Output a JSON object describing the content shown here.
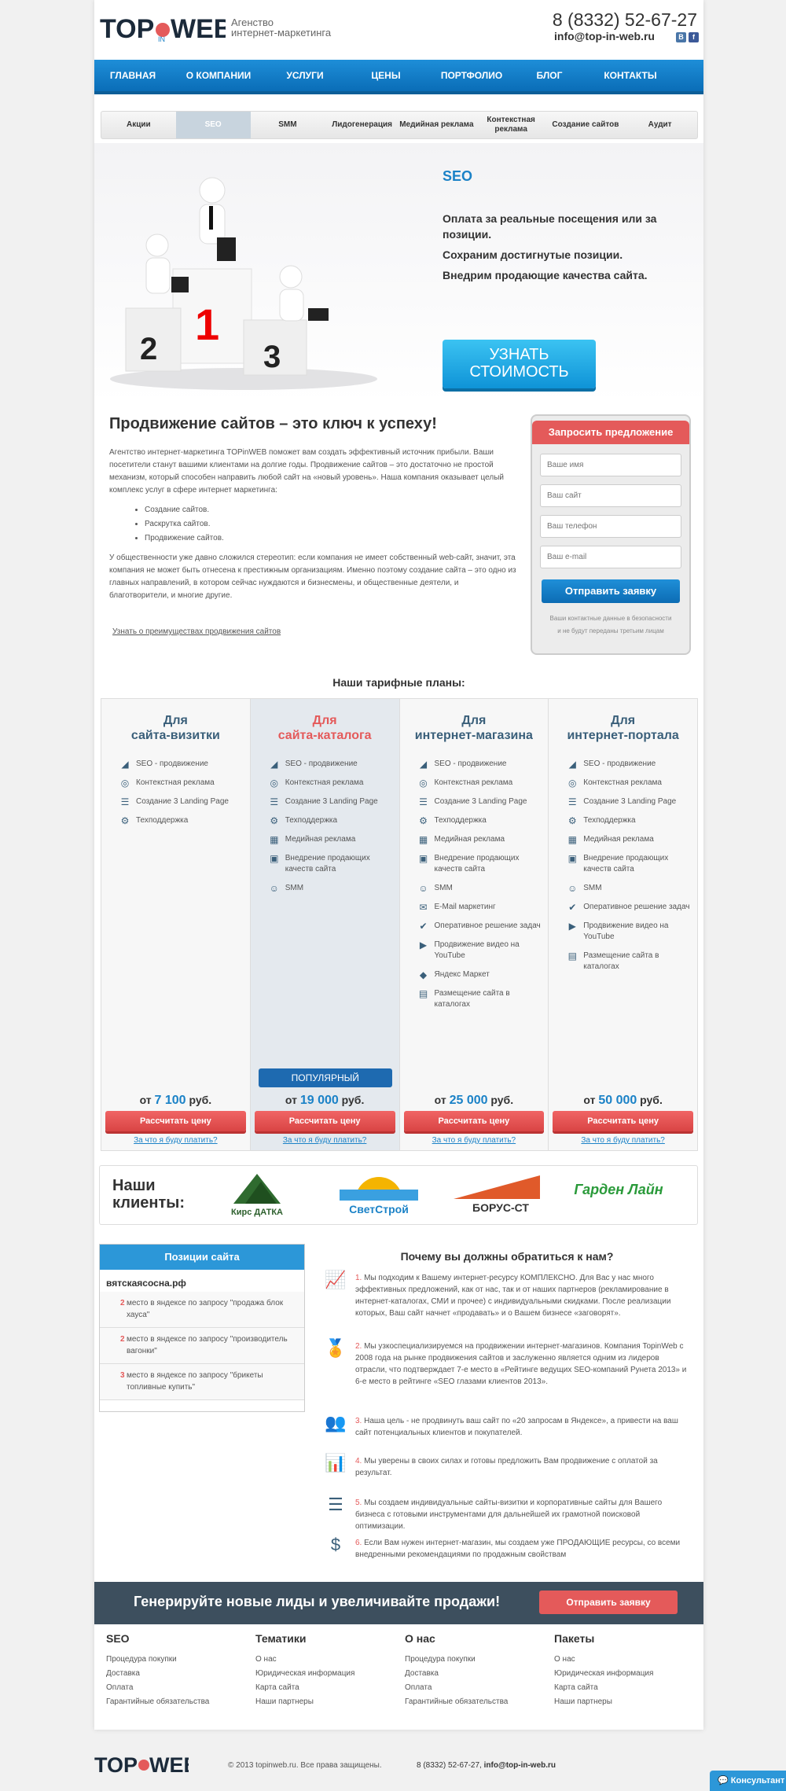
{
  "header": {
    "logo_text": "TOP IN WEB",
    "tagline_1": "Агенство",
    "tagline_2": "интернет-маркетинга",
    "phone": "8 (8332) 52-67-27",
    "email": "info@top-in-web.ru"
  },
  "nav": [
    "ГЛАВНАЯ",
    "О КОМПАНИИ",
    "УСЛУГИ",
    "ЦЕНЫ",
    "ПОРТФОЛИО",
    "БЛОГ",
    "КОНТАКТЫ"
  ],
  "subnav": [
    "Акции",
    "SEO",
    "SMM",
    "Лидогенерация",
    "Медийная реклама",
    "Контекстная реклама",
    "Создание сайтов",
    "Аудит"
  ],
  "hero": {
    "title": "SEO",
    "lines": [
      "Оплата за реальные посещения или за позиции.",
      "Сохраним достигнутые позиции.",
      "Внедрим продающие качества сайта."
    ],
    "button": "УЗНАТЬ СТОИМОСТЬ"
  },
  "intro": {
    "heading": "Продвижение сайтов – это ключ к успеху!",
    "p1": "Агентство интернет-маркетинга TOPinWEB поможет вам создать эффективный источник прибыли. Ваши посетители станут вашими клиентами на долгие годы. Продвижение сайтов – это достаточно не простой механизм, который способен направить любой сайт на «новый уровень». Наша компания оказывает целый комплекс услуг в сфере интернет маркетинга:",
    "list": [
      "Создание сайтов.",
      "Раскрутка сайтов.",
      "Продвижение сайтов."
    ],
    "p2": "У общественности уже давно сложился стереотип: если компания не имеет собственный web-сайт, значит, эта компания не может быть отнесена к престижным организациям. Именно поэтому создание сайта – это одно из главных направлений, в котором сейчас нуждаются и бизнесмены, и общественные деятели, и благотворители, и многие другие.",
    "link": "Узнать о преимуществах продвижения сайтов"
  },
  "form": {
    "title": "Запросить предложение",
    "name_ph": "Ваше имя",
    "site_ph": "Ваш сайт",
    "phone_ph": "Ваш телефон",
    "email_ph": "Ваш e-mail",
    "submit": "Отправить заявку",
    "note1": "Ваши контактные данные в безопасности",
    "note2": "и не будут переданы третьим лицам"
  },
  "plans_title": "Наши тарифные планы:",
  "plans": [
    {
      "name1": "Для",
      "name2": "сайта-визитки",
      "features": [
        "SEO - продвижение",
        "Контекстная реклама",
        "Создание 3 Landing Page",
        "Техподдержка"
      ],
      "price_prefix": "от",
      "price": "7 100",
      "currency": "руб.",
      "button": "Рассчитать цену",
      "why": "За что я буду платить?"
    },
    {
      "name1": "Для",
      "name2": "сайта-каталога",
      "features": [
        "SEO - продвижение",
        "Контекстная реклама",
        "Создание 3 Landing Page",
        "Техподдержка",
        "Медийная реклама",
        "Внедрение продающих качеств сайта",
        "SMM"
      ],
      "price_prefix": "от",
      "price": "19 000",
      "currency": "руб.",
      "button": "Рассчитать цену",
      "why": "За что я буду платить?",
      "ribbon": "ПОПУЛЯРНЫЙ"
    },
    {
      "name1": "Для",
      "name2": "интернет-магазина",
      "features": [
        "SEO - продвижение",
        "Контекстная реклама",
        "Создание 3 Landing Page",
        "Техподдержка",
        "Медийная реклама",
        "Внедрение продающих качеств сайта",
        "SMM",
        "E-Mail маркетинг",
        "Оперативное решение задач",
        "Продвижение видео на YouTube",
        "Яндекс Маркет",
        "Размещение сайта в каталогах"
      ],
      "price_prefix": "от",
      "price": "25 000",
      "currency": "руб.",
      "button": "Рассчитать цену",
      "why": "За что я буду платить?"
    },
    {
      "name1": "Для",
      "name2": "интернет-портала",
      "features": [
        "SEO - продвижение",
        "Контекстная реклама",
        "Создание 3 Landing Page",
        "Техподдержка",
        "Медийная реклама",
        "Внедрение продающих качеств сайта",
        "SMM",
        "Оперативное решение задач",
        "Продвижение видео на YouTube",
        "Размещение сайта в каталогах"
      ],
      "price_prefix": "от",
      "price": "50 000",
      "currency": "руб.",
      "button": "Рассчитать цену",
      "why": "За что я буду платить?"
    }
  ],
  "clients": {
    "title1": "Наши",
    "title2": "клиенты:",
    "logos": [
      "Кирс ДАТКА",
      "СветСтрой",
      "БОРУС-СТ",
      "Гарден Лайн"
    ]
  },
  "positions": {
    "title": "Позиции сайта",
    "city": "вятскаясосна.рф",
    "items": [
      {
        "rank": "2",
        "text": "место в яндексе по запросу \"продажа блок хауса\""
      },
      {
        "rank": "2",
        "text": "место в яндексе по запросу \"производитель вагонки\""
      },
      {
        "rank": "3",
        "text": "место в яндексе по запросу \"брикеты топливные купить\""
      }
    ]
  },
  "whyus": {
    "title": "Почему вы должны обратиться к нам?",
    "items": [
      {
        "num": "1.",
        "text": "Мы подходим к Вашему интернет-ресурсу КОМПЛЕКСНО. Для Вас у нас много эффективных предложений, как от нас, так и от наших партнеров (рекламирование в интернет-каталогах, СМИ и прочее) с индивидуальными скидками. После реализации которых, Ваш сайт начнет «продавать» и о Вашем бизнесе «заговорят»."
      },
      {
        "num": "2.",
        "text": "Мы узкоспециализируемся на продвижении интернет-магазинов. Компания TopinWeb с 2008 года на рынке продвижения сайтов и заслуженно является одним из лидеров отрасли, что подтверждает 7-е место в «Рейтинге ведущих SEO-компаний Рунета 2013» и 6-е место в рейтинге «SEO глазами клиентов 2013»."
      },
      {
        "num": "3.",
        "text": "Наша цель - не продвинуть ваш сайт по «20 запросам в Яндексе», а привести на ваш сайт потенциальных клиентов и покупателей."
      },
      {
        "num": "4.",
        "text": "Мы уверены в своих силах и готовы предложить Вам продвижение с оплатой за результат."
      },
      {
        "num": "5.",
        "text": "Мы создаем индивидуальные сайты-визитки и корпоративные сайты для Вашего бизнеса с готовыми инструментами для дальнейшей их грамотной поисковой оптимизации."
      },
      {
        "num": "6.",
        "text": "Если Вам нужен интернет-магазин, мы создаем уже ПРОДАЮЩИЕ ресурсы, со всеми внедренными рекомендациями по продажным свойствам"
      }
    ]
  },
  "banner": {
    "text": "Генерируйте новые лиды и увеличивайте продажи!",
    "button": "Отправить заявку"
  },
  "footer": {
    "cols": [
      {
        "title": "SEO",
        "links": [
          "Процедура покупки",
          "Доставка",
          "Оплата",
          "Гарантийные обязательства"
        ]
      },
      {
        "title": "Тематики",
        "links": [
          "О нас",
          "Юридическая информация",
          "Карта сайта",
          "Наши партнеры"
        ]
      },
      {
        "title": "О нас",
        "links": [
          "Процедура покупки",
          "Доставка",
          "Оплата",
          "Гарантийные обязательства"
        ]
      },
      {
        "title": "Пакеты",
        "links": [
          "О нас",
          "Юридическая информация",
          "Карта сайта",
          "Наши партнеры"
        ]
      }
    ],
    "copyright": "© 2013 topinweb.ru. Все права защищены.",
    "phone": "8 (8332) 52-67-27,",
    "email": "info@top-in-web.ru",
    "consult": "Консультант"
  },
  "colors": {
    "accent": "#1b82c7",
    "nav": "#0a6db7",
    "red": "#e45a5a",
    "dark": "#3d4f5e"
  }
}
